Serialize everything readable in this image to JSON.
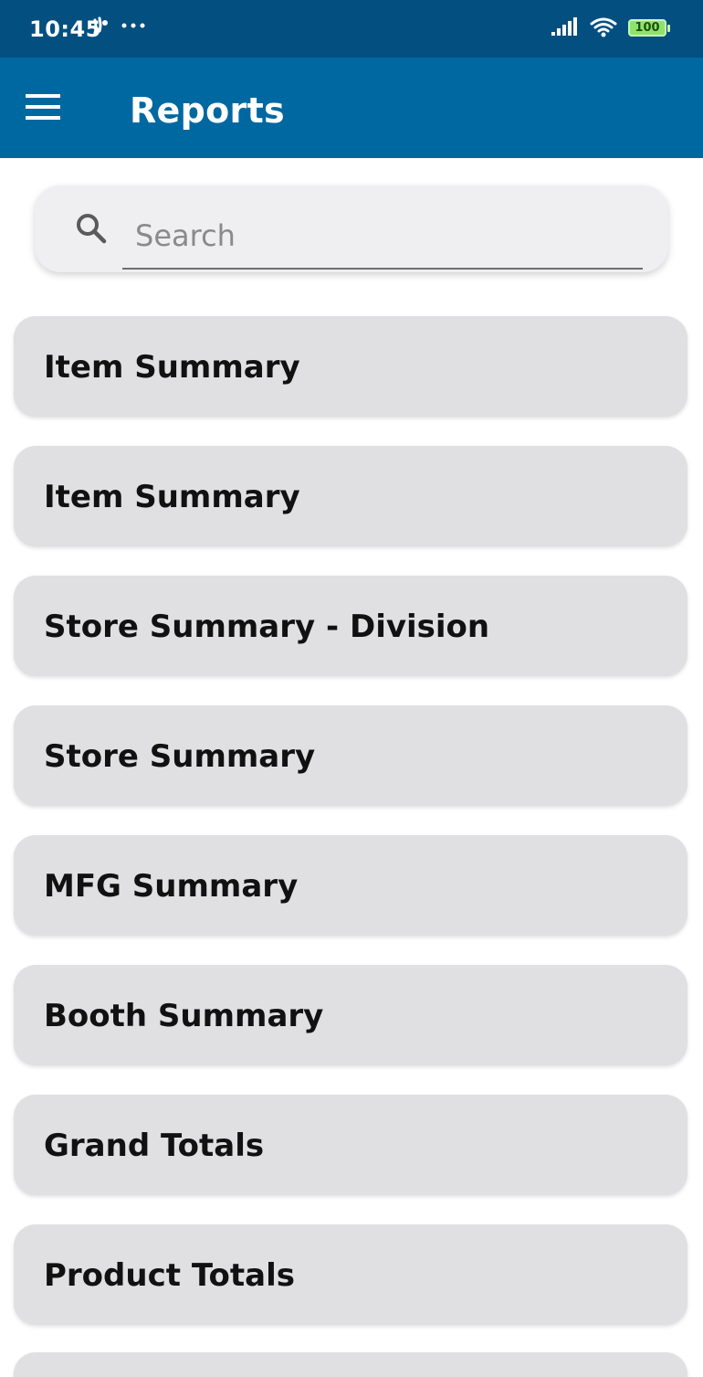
{
  "status_bar": {
    "time": "10:45",
    "icons": [
      "notification-icon",
      "more-dots-icon",
      "signal-icon",
      "wifi-icon",
      "battery-icon"
    ],
    "battery_level": "100"
  },
  "app_bar": {
    "title": "Reports",
    "menu_icon": "hamburger-menu-icon",
    "background": "#0068a1"
  },
  "search": {
    "placeholder": "Search",
    "value": ""
  },
  "reports": [
    {
      "label": "Item Summary"
    },
    {
      "label": "Item Summary"
    },
    {
      "label": "Store Summary - Division"
    },
    {
      "label": "Store Summary"
    },
    {
      "label": "MFG Summary"
    },
    {
      "label": "Booth Summary"
    },
    {
      "label": "Grand Totals"
    },
    {
      "label": "Product Totals"
    },
    {
      "label": ""
    }
  ]
}
